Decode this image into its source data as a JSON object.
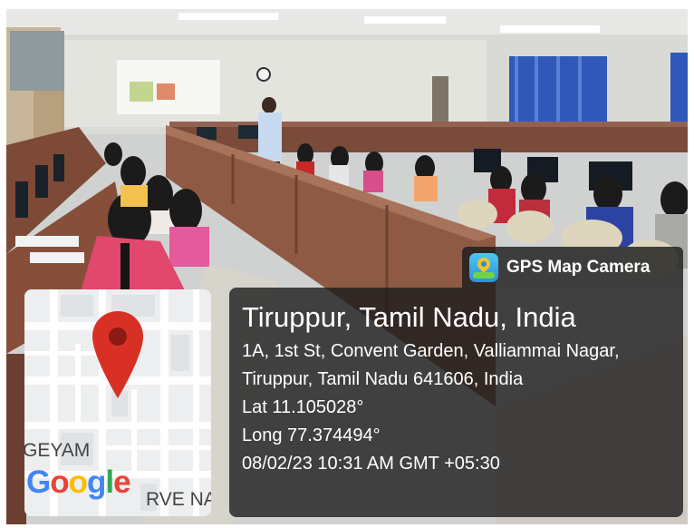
{
  "overlay": {
    "app_label": "GPS Map Camera",
    "app_icon": "gps-map-camera-app-icon",
    "place_title": "Tiruppur, Tamil Nadu, India",
    "address": "1A, 1st St, Convent Garden, Valliammai Nagar, Tiruppur, Tamil Nadu 641606, India",
    "latitude": "Lat 11.105028°",
    "longitude": "Long 77.374494°",
    "datetime": "08/02/23 10:31 AM GMT +05:30",
    "panel_color": "#1c1c1c"
  },
  "map": {
    "street_label_left": "GEYAM",
    "street_label_right": "RVE NA",
    "logo_letters": [
      "G",
      "o",
      "o",
      "g",
      "l",
      "e"
    ],
    "logo_colors": [
      "#4285f4",
      "#ea4335",
      "#fbbc05",
      "#4285f4",
      "#34a853",
      "#ea4335"
    ],
    "pin_color": "#d93025",
    "pin_icon": "map-pin-icon"
  }
}
